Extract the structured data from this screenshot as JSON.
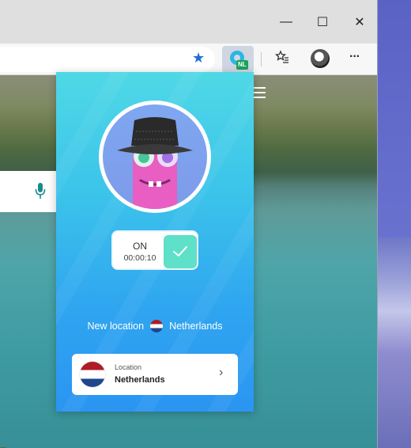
{
  "window": {
    "minimize_glyph": "—",
    "maximize_glyph": "☐",
    "close_glyph": "✕"
  },
  "toolbar": {
    "extension_badge": "NL",
    "more_glyph": "···"
  },
  "popup": {
    "status_text": "ON",
    "timer": "00:00:10",
    "new_location_label": "New location",
    "new_location_country": "Netherlands",
    "location_card": {
      "label": "Location",
      "value": "Netherlands"
    }
  },
  "colors": {
    "accent_toggle": "#5fe0c8",
    "popup_top": "#4fd8e6",
    "popup_bottom": "#2a95f2",
    "favorite_star": "#1f6fd1"
  },
  "icons": {
    "favorite": "star-icon",
    "extension": "vpn-extension-icon",
    "favorites_list": "favorites-icon",
    "profile": "avatar",
    "more": "more-icon",
    "mic": "mic-icon",
    "menu": "hamburger-icon",
    "check": "check-icon",
    "chevron": "chevron-right-icon"
  }
}
